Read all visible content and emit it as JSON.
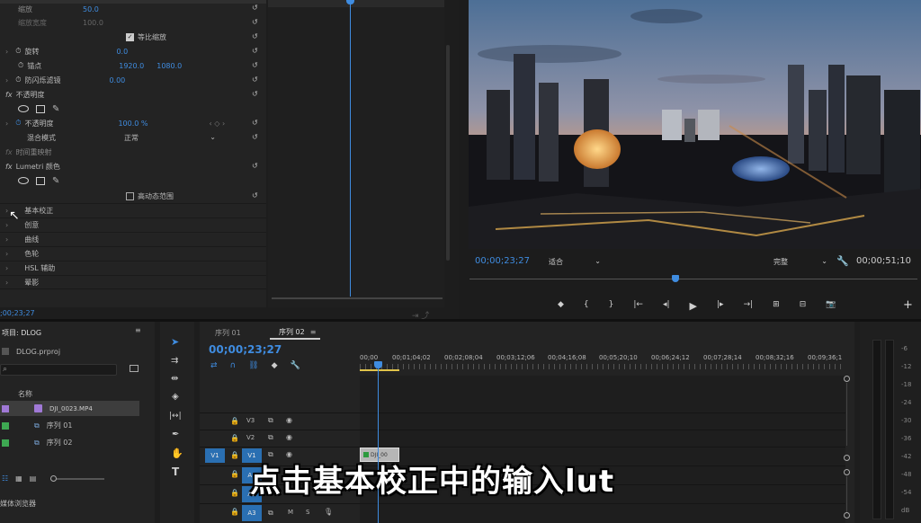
{
  "effects": {
    "clip_name": "DJI_0023.MP4",
    "rows": {
      "scale": "缩放",
      "scale_val": "50.0",
      "scale_w": "缩放宽度",
      "scale_w_val": "100.0",
      "uniform": "等比缩放",
      "rotation": "旋转",
      "rotation_val": "0.0",
      "anchor": "锚点",
      "anchor_x": "1920.0",
      "anchor_y": "1080.0",
      "flicker": "防闪烁滤镜",
      "flicker_val": "0.00",
      "opacity_fx": "不透明度",
      "opacity": "不透明度",
      "opacity_val": "100.0 %",
      "blend": "混合模式",
      "blend_val": "正常",
      "time_remap": "时间重映射",
      "lumetri": "Lumetri 颜色",
      "hdr": "高动态范围",
      "basic": "基本校正",
      "creative": "创意",
      "curves": "曲线",
      "wheels": "色轮",
      "hsl": "HSL 辅助",
      "vignette": "晕影"
    },
    "timecode": ";00;23;27"
  },
  "program": {
    "timecode_left": "00;00;23;27",
    "fit": "适合",
    "quality": "完整",
    "timecode_right": "00;00;51;10"
  },
  "project": {
    "title": "项目: DLOG",
    "file": "DLOG.prproj",
    "col_name": "名称",
    "items": [
      "DJI_0023.MP4",
      "序列 01",
      "序列 02"
    ],
    "browser": "媒体浏览器"
  },
  "timeline": {
    "tab1": "序列 01",
    "tab2": "序列 02",
    "timecode": "00;00;23;27",
    "ruler": [
      "00;00",
      "00;01;04;02",
      "00;02;08;04",
      "00;03;12;06",
      "00;04;16;08",
      "00;05;20;10",
      "00;06;24;12",
      "00;07;28;14",
      "00;08;32;16",
      "00;09;36;1"
    ],
    "tracks": [
      "V3",
      "V2",
      "V1",
      "A1",
      "A2",
      "A3"
    ],
    "source_v1": "V1",
    "clip_label": "DJI_00",
    "caption": "点击基本校正中的输入lut"
  },
  "meter": {
    "scale": [
      "-6",
      "-12",
      "-18",
      "-24",
      "-30",
      "-36",
      "-42",
      "-48",
      "-54",
      "dB"
    ]
  },
  "colors": {
    "accent": "#3f8ce0",
    "playhead": "#3f8ce0",
    "track_blue": "#2a6fb2"
  }
}
